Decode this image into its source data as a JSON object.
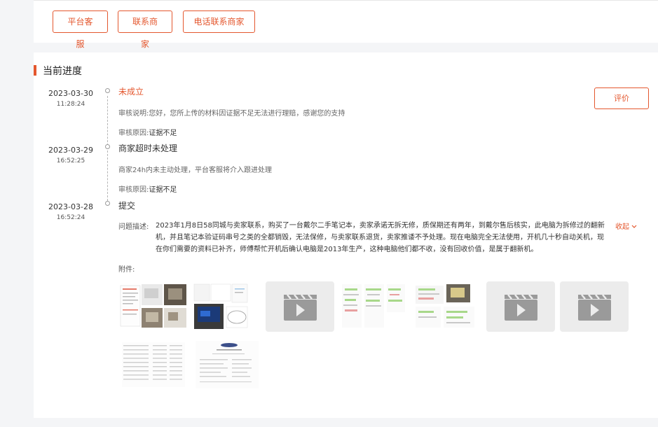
{
  "top_buttons": [
    {
      "label": "平台客",
      "wrap": "服"
    },
    {
      "label": "联系商",
      "wrap": "家"
    },
    {
      "label": "电话联系商家",
      "wrap": ""
    }
  ],
  "section": {
    "title": "当前进度"
  },
  "evaluate_label": "评价",
  "timeline": [
    {
      "date": "2023-03-30",
      "time": "11:28:24",
      "title": "未成立",
      "lines": [
        {
          "label": "审核说明:",
          "value": "您好，您所上传的材料因证据不足无法进行理赔，感谢您的支持"
        },
        {
          "label": "审核原因:",
          "value": "证据不足"
        }
      ]
    },
    {
      "date": "2023-03-29",
      "time": "16:52:25",
      "title": "商家超时未处理",
      "lines": [
        {
          "label": "",
          "value": "商家24h内未主动处理，平台客服将介入跟进处理"
        },
        {
          "label": "审核原因:",
          "value": "证据不足"
        }
      ]
    },
    {
      "date": "2023-03-28",
      "time": "16:52:24",
      "title": "提交"
    }
  ],
  "problem": {
    "label": "问题描述:",
    "text": "2023年1月8日58同城与卖家联系，购买了一台戴尔二手笔记本，卖家承诺无拆无修，质保期还有两年，到戴尔售后核实，此电脑为拆修过的翻新机，并且笔记本验证码串号之类的全都销毁，无法保修，与卖家联系退货，卖家推诿不予处理。现在电脑完全无法使用，开机几十秒自动关机，现在你们需要的资料已补齐，师傅帮忙开机后确认电脑是2013年生产，这种电脑他们都不收，没有回收价值，是属于翻新机。",
    "collapse_label": "收起"
  },
  "attachments": {
    "label": "附件:",
    "items": [
      {
        "kind": "image"
      },
      {
        "kind": "image"
      },
      {
        "kind": "video"
      },
      {
        "kind": "image"
      },
      {
        "kind": "image"
      },
      {
        "kind": "video"
      },
      {
        "kind": "video"
      },
      {
        "kind": "image"
      },
      {
        "kind": "image"
      }
    ]
  },
  "colors": {
    "accent": "#e4572e",
    "video_bg": "#ececec",
    "play_icon": "#9a9a9a"
  }
}
